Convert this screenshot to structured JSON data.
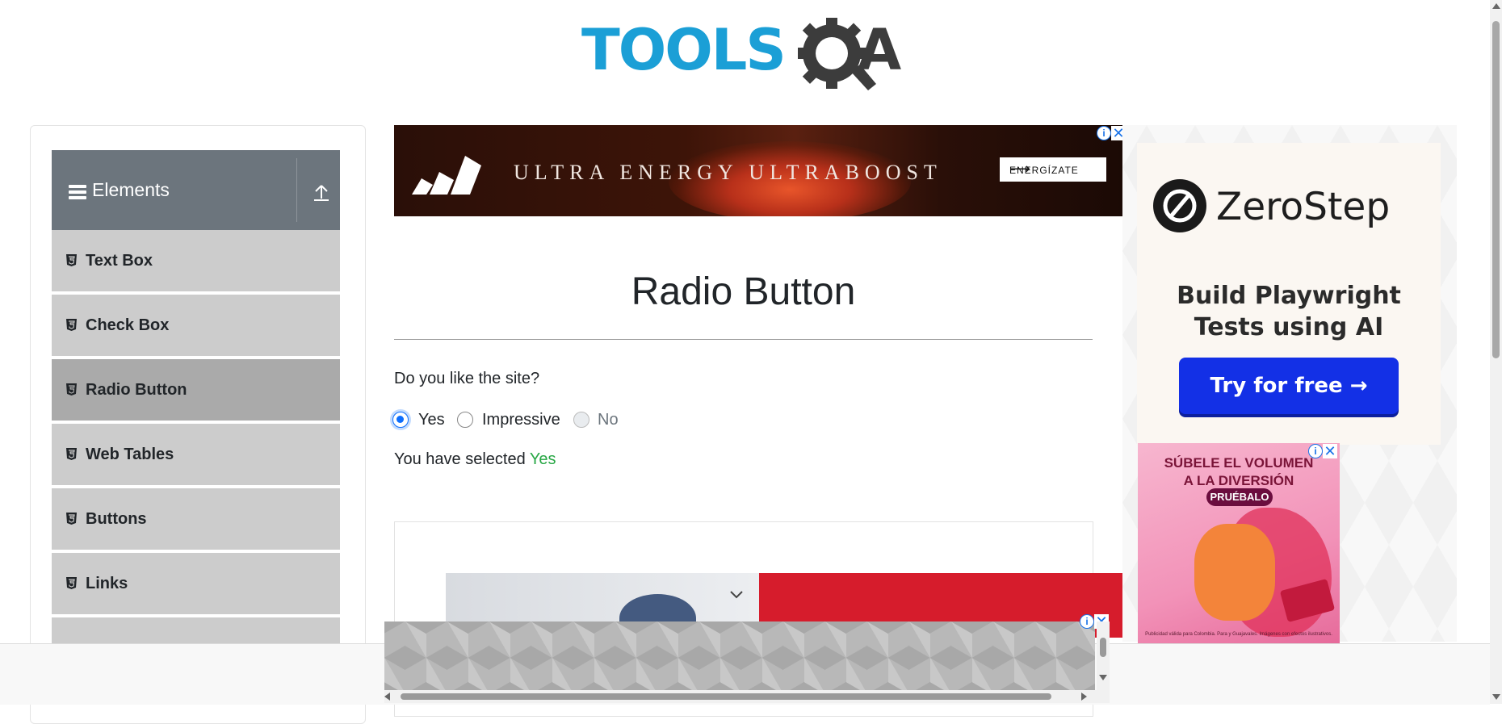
{
  "logo": {
    "part1": "TOOLS",
    "part2": "A"
  },
  "sidebar": {
    "group_title": "Elements",
    "items": [
      {
        "label": "Text Box"
      },
      {
        "label": "Check Box"
      },
      {
        "label": "Radio Button",
        "active": true
      },
      {
        "label": "Web Tables"
      },
      {
        "label": "Buttons"
      },
      {
        "label": "Links"
      }
    ]
  },
  "ad_top": {
    "headline": "ULTRA ENERGY   ULTRABOOST",
    "cta": "ENERGÍZATE"
  },
  "main": {
    "title": "Radio Button",
    "question": "Do you like the site?",
    "options": [
      {
        "label": "Yes",
        "checked": true,
        "disabled": false
      },
      {
        "label": "Impressive",
        "checked": false,
        "disabled": false
      },
      {
        "label": "No",
        "checked": false,
        "disabled": true
      }
    ],
    "result_prefix": "You have selected ",
    "result_value": "Yes"
  },
  "ad_right": {
    "brand": "ZeroStep",
    "tagline_line1": "Build Playwright",
    "tagline_line2": "Tests using AI",
    "cta": "Try for free →"
  },
  "ad_small": {
    "headline_line1": "SÚBELE EL VOLUMEN",
    "headline_line2": "A LA DIVERSIÓN",
    "cta": "PRUÉBALO",
    "fine_print": "Publicidad válida para Colombia. Para y Guajavales. Imágenes con efectos ilustrativos."
  },
  "colors": {
    "accent": "#0d6efd",
    "success": "#28a745",
    "sidebar_header": "#6c757d",
    "sidebar_item": "#cccccc",
    "sidebar_active": "#aaaaaa"
  }
}
